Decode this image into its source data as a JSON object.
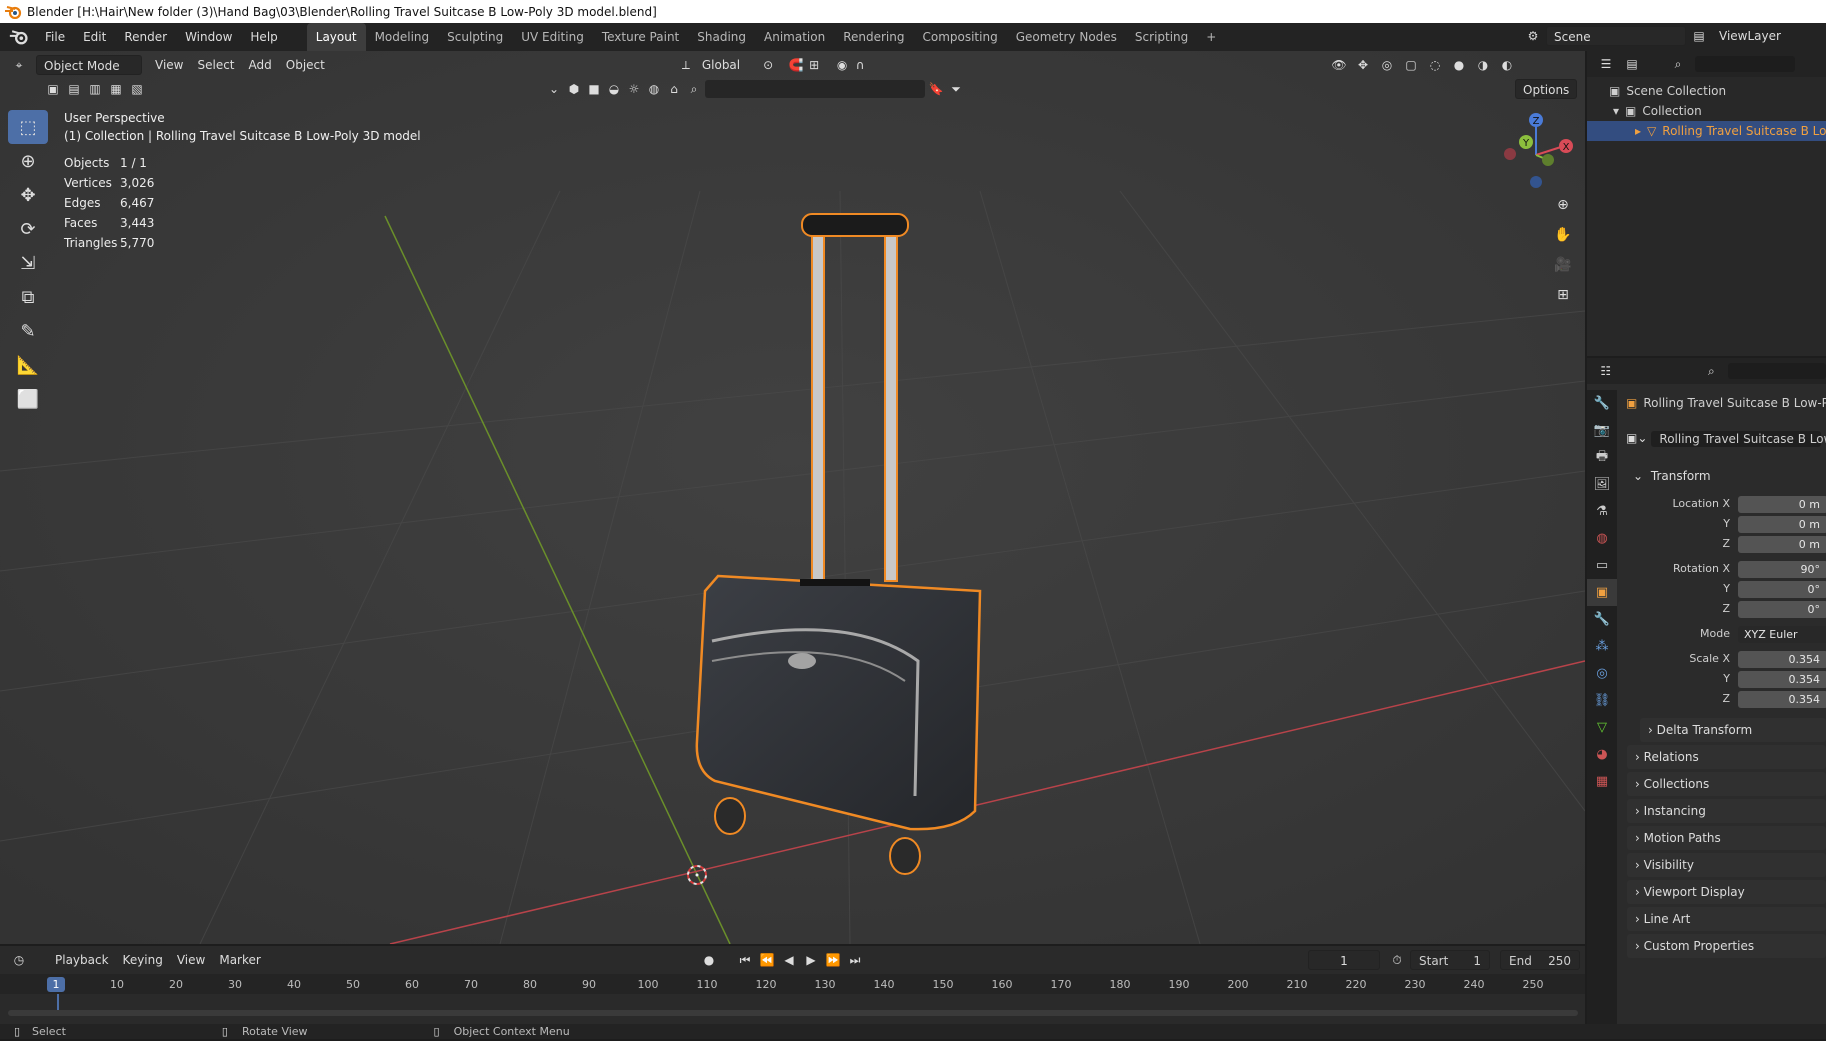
{
  "window": {
    "title": "Blender [H:\\Hair\\New folder (3)\\Hand Bag\\03\\Blender\\Rolling Travel Suitcase B Low-Poly 3D model.blend]"
  },
  "menubar": {
    "items": [
      "File",
      "Edit",
      "Render",
      "Window",
      "Help"
    ]
  },
  "workspaces": {
    "tabs": [
      "Layout",
      "Modeling",
      "Sculpting",
      "UV Editing",
      "Texture Paint",
      "Shading",
      "Animation",
      "Rendering",
      "Compositing",
      "Geometry Nodes",
      "Scripting"
    ],
    "active": "Layout",
    "add": "+"
  },
  "scene": {
    "scene_label": "Scene",
    "viewlayer_label": "ViewLayer"
  },
  "viewport": {
    "mode": "Object Mode",
    "menus": [
      "View",
      "Select",
      "Add",
      "Object"
    ],
    "orientation": "Global",
    "options_label": "Options",
    "perspective_label": "User Perspective",
    "collection_info": "(1) Collection | Rolling Travel Suitcase B Low-Poly 3D model",
    "stats": [
      {
        "label": "Objects",
        "value": "1 / 1"
      },
      {
        "label": "Vertices",
        "value": "3,026"
      },
      {
        "label": "Edges",
        "value": "6,467"
      },
      {
        "label": "Faces",
        "value": "3,443"
      },
      {
        "label": "Triangles",
        "value": "5,770"
      }
    ],
    "gizmo": {
      "z": "Z",
      "y": "Y",
      "x": "X"
    }
  },
  "outliner": {
    "items": [
      {
        "label": "Scene Collection",
        "depth": 0
      },
      {
        "label": "Collection",
        "depth": 1
      },
      {
        "label": "Rolling Travel Suitcase B Low-P",
        "depth": 2,
        "selected": true
      }
    ]
  },
  "properties": {
    "object_name": "Rolling Travel Suitcase B Low-Poly",
    "object_name_field": "Rolling Travel Suitcase B Low-Po",
    "transform": {
      "header": "Transform",
      "location_label": "Location X",
      "location": [
        "0 m",
        "0 m",
        "0 m"
      ],
      "rotation_label": "Rotation X",
      "rotation": [
        "90°",
        "0°",
        "0°"
      ],
      "mode_label": "Mode",
      "mode": "XYZ Euler",
      "scale_label": "Scale X",
      "scale": [
        "0.354",
        "0.354",
        "0.354"
      ],
      "y": "Y",
      "z": "Z"
    },
    "panels": [
      "Delta Transform",
      "Relations",
      "Collections",
      "Instancing",
      "Motion Paths",
      "Visibility",
      "Viewport Display",
      "Line Art",
      "Custom Properties"
    ]
  },
  "timeline": {
    "menus": [
      "Playback",
      "Keying",
      "View",
      "Marker"
    ],
    "current_frame": "1",
    "start_label": "Start",
    "start": "1",
    "end_label": "End",
    "end": "250",
    "ticks": [
      "10",
      "20",
      "30",
      "40",
      "50",
      "60",
      "70",
      "80",
      "90",
      "100",
      "110",
      "120",
      "130",
      "140",
      "150",
      "160",
      "170",
      "180",
      "190",
      "200",
      "210",
      "220",
      "230",
      "240",
      "250"
    ],
    "playhead": "1"
  },
  "statusbar": {
    "items": [
      "Select",
      "Rotate View",
      "Object Context Menu"
    ]
  },
  "colors": {
    "selection_orange": "#f08a24",
    "x_axis": "#b8434a",
    "y_axis": "#6a8f2a",
    "accent": "#4d6fa7"
  }
}
